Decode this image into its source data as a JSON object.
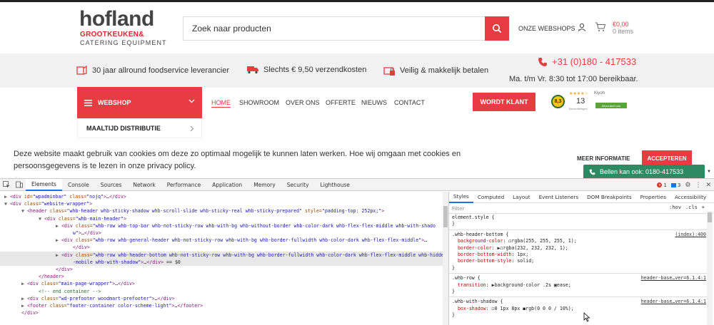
{
  "site": {
    "logo": {
      "main": "hofland",
      "line1": "GROOTKEUKEN&",
      "line2": "CATERING  EQUIPMENT"
    },
    "search": {
      "placeholder": "Zoek naar producten"
    },
    "header": {
      "webshops": "ONZE WEBSHOPS",
      "cart_price": "€0,00",
      "cart_items": "0 items"
    },
    "usps": [
      {
        "text": "30 jaar allround foodservice leverancier",
        "icon": "foodservice-icon"
      },
      {
        "text": "Slechts € 9,50 verzendkosten",
        "icon": "truck-icon"
      },
      {
        "text": "Veilig & makkelijk betalen",
        "icon": "secure-payment-icon"
      }
    ],
    "phone": "+31 (0)180 - 417533",
    "hours": "Ma. t/m Vr. 8:30 tot 17:00 bereikbaar.",
    "webshop_menu": "WEBSHOP",
    "nav": [
      "HOME",
      "SHOWROOM",
      "OVER ONS",
      "OFFERTE",
      "NIEUWS",
      "CONTACT"
    ],
    "cta": "WORDT KLANT",
    "kiyoh": {
      "score": "8,3",
      "stars": "★★★★☆",
      "name": "Kiyoh",
      "count": "13",
      "label": "Beoordelingen",
      "badge": "Beoordeel ons"
    },
    "dropdown_item": "MAALTIJD DISTRIBUTIE",
    "cookie": {
      "text": "Deze website maakt gebruik van cookies om deze zo optimaal mogelijk te kunnen laten werken. Hoe wij omgaan met cookies en persoonsgegevens is te lezen in onze privacy policy.",
      "more": "MEER INFORMATIE",
      "accept": "ACCEPTEREN"
    },
    "callbar": "Bellen kan ook: 0180-417533",
    "colors": {
      "brand_red": "#e63c42",
      "call_green": "#2f8a63"
    }
  },
  "devtools": {
    "tabs": [
      "Elements",
      "Console",
      "Sources",
      "Network",
      "Performance",
      "Application",
      "Memory",
      "Security",
      "Lighthouse"
    ],
    "active_tab": "Elements",
    "error_count": "1",
    "message_count": "3",
    "elements": [
      {
        "indent": 2,
        "arrow": "▶",
        "parts": [
          [
            "tag",
            "<div "
          ],
          [
            "attr",
            "id="
          ],
          [
            "val",
            "\"wpadminbar\""
          ],
          [
            "attr",
            " class="
          ],
          [
            "val",
            "\"nojq\""
          ],
          [
            "tag",
            ">"
          ],
          [
            "txt",
            "…"
          ],
          [
            "tag",
            "</div>"
          ]
        ]
      },
      {
        "indent": 2,
        "arrow": "▼",
        "parts": [
          [
            "tag",
            "<div "
          ],
          [
            "attr",
            "class="
          ],
          [
            "val",
            "\"website-wrapper\""
          ],
          [
            "tag",
            ">"
          ]
        ]
      },
      {
        "indent": 10,
        "arrow": "▼",
        "parts": [
          [
            "tag",
            "<header "
          ],
          [
            "attr",
            "class="
          ],
          [
            "val",
            "\"whb-header whb-sticky-shadow whb-scroll-slide whb-sticky-real whb-sticky-prepared\""
          ],
          [
            "attr",
            " style="
          ],
          [
            "val",
            "\"padding-top: 252px;\""
          ],
          [
            "tag",
            ">"
          ]
        ]
      },
      {
        "indent": 18,
        "arrow": "▼",
        "parts": [
          [
            "tag",
            "<div "
          ],
          [
            "attr",
            "class="
          ],
          [
            "val",
            "\"whb-main-header\""
          ],
          [
            "tag",
            ">"
          ]
        ]
      },
      {
        "indent": 26,
        "arrow": "▶",
        "parts": [
          [
            "tag",
            "<div "
          ],
          [
            "attr",
            "class="
          ],
          [
            "val",
            "\"whb-row whb-top-bar whb-not-sticky-row whb-with-bg whb-without-border whb-color-dark whb-flex-flex-middle whb-with-shado"
          ]
        ]
      },
      {
        "indent": 34,
        "arrow": "",
        "parts": [
          [
            "val",
            "w\""
          ],
          [
            "tag",
            ">"
          ],
          [
            "txt",
            "…"
          ],
          [
            "tag",
            "</div>"
          ]
        ]
      },
      {
        "indent": 26,
        "arrow": "▶",
        "parts": [
          [
            "tag",
            "<div "
          ],
          [
            "attr",
            "class="
          ],
          [
            "val",
            "\"whb-row whb-general-header whb-not-sticky-row whb-with-bg whb-border-fullwidth whb-color-dark whb-flex-flex-middle\""
          ],
          [
            "tag",
            ">"
          ],
          [
            "txt",
            "…"
          ]
        ]
      },
      {
        "indent": 34,
        "arrow": "",
        "parts": [
          [
            "tag",
            "</div>"
          ]
        ]
      },
      {
        "indent": 26,
        "arrow": "▶",
        "sel": true,
        "parts": [
          [
            "tag",
            "<div "
          ],
          [
            "attr",
            "class="
          ],
          [
            "val",
            "\"whb-row whb-header-bottom whb-not-sticky-row whb-with-bg whb-border-fullwidth whb-color-dark whb-flex-flex-middle whb-hidden"
          ]
        ]
      },
      {
        "indent": 34,
        "arrow": "",
        "sel": true,
        "parts": [
          [
            "val",
            "-mobile whb-with-shadow\""
          ],
          [
            "tag",
            ">"
          ],
          [
            "txt",
            "…"
          ],
          [
            "tag",
            "</div>"
          ],
          [
            "txt",
            " == $0"
          ]
        ]
      },
      {
        "indent": 26,
        "arrow": "",
        "parts": [
          [
            "tag",
            "</div>"
          ]
        ]
      },
      {
        "indent": 18,
        "arrow": "",
        "parts": [
          [
            "tag",
            "</header>"
          ]
        ]
      },
      {
        "indent": 10,
        "arrow": "▶",
        "parts": [
          [
            "tag",
            "<div "
          ],
          [
            "attr",
            "class="
          ],
          [
            "val",
            "\"main-page-wrapper\""
          ],
          [
            "tag",
            ">"
          ],
          [
            "txt",
            "…"
          ],
          [
            "tag",
            "</div>"
          ]
        ]
      },
      {
        "indent": 18,
        "arrow": "",
        "parts": [
          [
            "com",
            "<!-- end container -->"
          ]
        ]
      },
      {
        "indent": 10,
        "arrow": "▶",
        "parts": [
          [
            "tag",
            "<div "
          ],
          [
            "attr",
            "class="
          ],
          [
            "val",
            "\"wd-prefooter woodmart-prefooter\""
          ],
          [
            "tag",
            ">"
          ],
          [
            "txt",
            "…"
          ],
          [
            "tag",
            "</div>"
          ]
        ]
      },
      {
        "indent": 10,
        "arrow": "▶",
        "parts": [
          [
            "tag",
            "<footer "
          ],
          [
            "attr",
            "class="
          ],
          [
            "val",
            "\"footer-container color-scheme-light\""
          ],
          [
            "tag",
            ">"
          ],
          [
            "txt",
            "…"
          ],
          [
            "tag",
            "</footer>"
          ]
        ]
      },
      {
        "indent": 10,
        "arrow": "",
        "parts": [
          [
            "tag",
            "</div>"
          ]
        ]
      }
    ],
    "style_tabs": [
      "Styles",
      "Computed",
      "Layout",
      "Event Listeners",
      "DOM Breakpoints",
      "Properties",
      "Accessibility"
    ],
    "filter_placeholder": "Filter",
    "filter_tools": [
      ":hov",
      ".cls",
      "+"
    ],
    "rules": [
      {
        "lines": [
          "element.style {",
          "}"
        ]
      },
      {
        "source": "(index):400",
        "lines": [
          ".whb-header-bottom {",
          "  background-color: ◻rgba(255, 255, 255, 1);",
          "  border-color: ▶◻rgba(232, 232, 232, 1);",
          "  border-bottom-width: 1px;",
          "  border-bottom-style: solid;",
          "}"
        ]
      },
      {
        "source": "header-base…ver=6.1.4:1",
        "lines": [
          ".whb-row {",
          "  transition: ▶background-color .2s ▣ease;",
          "}"
        ]
      },
      {
        "source": "header-base…ver=6.1.4:1",
        "lines": [
          ".whb-with-shadow {",
          "  box-shadow: ◻0 1px 8px ◼rgb(0 0 0 / 10%);",
          "}"
        ]
      }
    ]
  }
}
